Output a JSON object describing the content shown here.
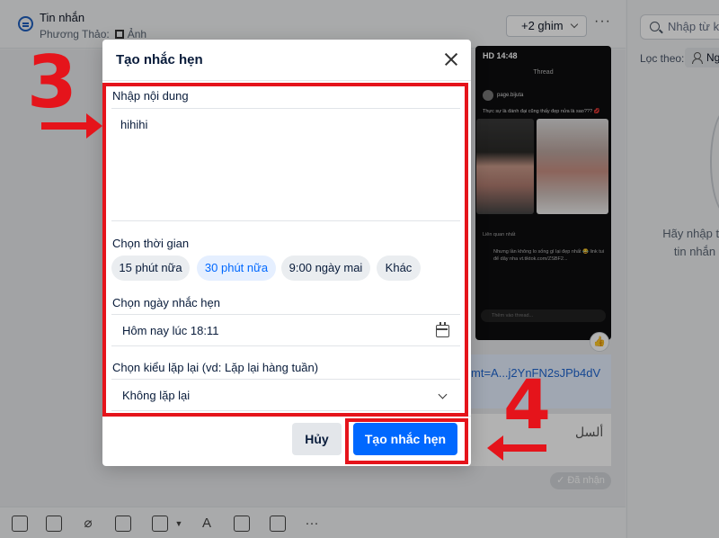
{
  "header": {
    "title": "Tin nhắn",
    "subtitle_name": "Phương Thảo:",
    "subtitle_attachment": "Ảnh",
    "pin_button": "+2 ghim"
  },
  "right_panel": {
    "search_placeholder": "Nhập từ kh",
    "filter_label": "Lọc theo:",
    "filter_chip": "Ngư",
    "empty_line1": "Hãy nhập từ",
    "empty_line2": "tin nhắn"
  },
  "chat": {
    "phone_status": "HD 14:48",
    "phone_title": "Thread",
    "phone_user": "page.bijuta",
    "phone_caption": "Thực sự là đánh đại cũng thấy đẹp nửa là sao??? 💋",
    "phone_related": "Liên quan nhất",
    "phone_comment": "Nhưng lần không lo sống gì lại đẹp nhất 😂 link tui để dây nha vt.tiktok.com/ZSBF2...",
    "phone_input": "Thêm vào thread...",
    "link_text": "mt=A...j2YnFN2sJPb4dV",
    "image_text": "ألسل",
    "seen_badge": "✓ Đã nhận"
  },
  "modal": {
    "title": "Tạo nhắc hẹn",
    "content_label": "Nhập nội dung",
    "content_value": "hihihi",
    "time_label": "Chọn thời gian",
    "time_options": [
      "15 phút nữa",
      "30 phút nữa",
      "9:00 ngày mai",
      "Khác"
    ],
    "selected_time_option": "30 phút nữa",
    "date_label": "Chọn ngày nhắc hẹn",
    "date_value": "Hôm nay lúc 18:11",
    "repeat_label": "Chọn kiểu lặp lại (vd: Lặp lại hàng tuần)",
    "repeat_value": "Không lặp lại",
    "cancel_label": "Hủy",
    "create_label": "Tạo nhắc hẹn"
  },
  "annotations": {
    "step_3": "3",
    "step_4": "4",
    "color": "#e5141b"
  },
  "colors": {
    "accent": "#0068ff",
    "accent_soft": "#e5efff",
    "text": "#081b3a"
  },
  "icons": [
    "chat-icon",
    "qr-icon",
    "chevron-down-icon",
    "more-icon",
    "search-icon",
    "person-icon",
    "like-icon",
    "close-icon",
    "calendar-icon",
    "sticker-icon",
    "image-icon",
    "attach-icon",
    "contact-card-icon",
    "screenshot-icon",
    "text-format-icon",
    "quick-message-icon",
    "card-icon"
  ]
}
